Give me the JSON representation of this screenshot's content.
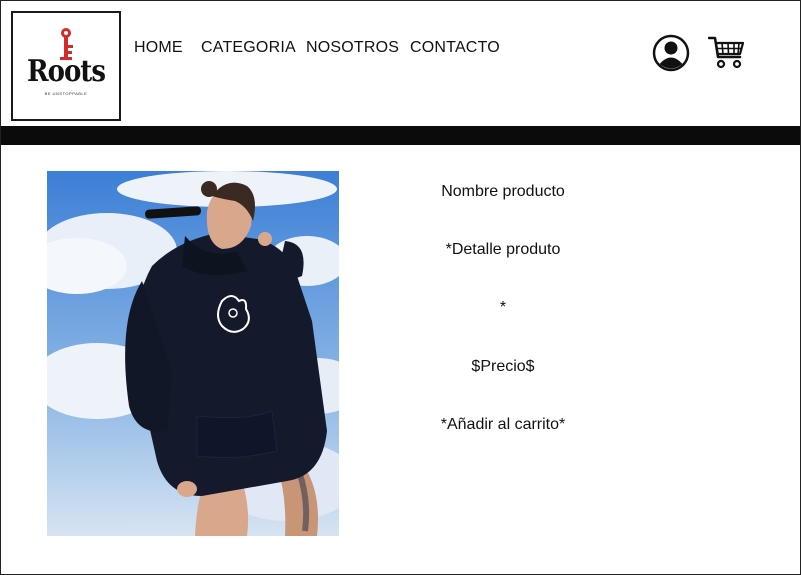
{
  "brand": {
    "logo_text": "Roots",
    "logo_subtext": "BE UNSTOPPABLE"
  },
  "nav": {
    "items": [
      {
        "label": "HOME"
      },
      {
        "label": "CATEGORIA"
      },
      {
        "label": "NOSOTROS"
      },
      {
        "label": "CONTACTO"
      }
    ]
  },
  "header_icons": {
    "account": "user-account-icon",
    "cart": "shopping-cart-icon"
  },
  "product": {
    "image": "product-photo-hoodie",
    "name": "Nombre producto",
    "detail": "*Detalle produto",
    "separator": "*",
    "price": "$Precio$",
    "add_to_cart": "*Añadir al carrito*"
  },
  "colors": {
    "band": "#0b0b0b",
    "logo_accent": "#d42a2a",
    "sky": "#4f8fd9",
    "hoodie": "#141a2b"
  }
}
